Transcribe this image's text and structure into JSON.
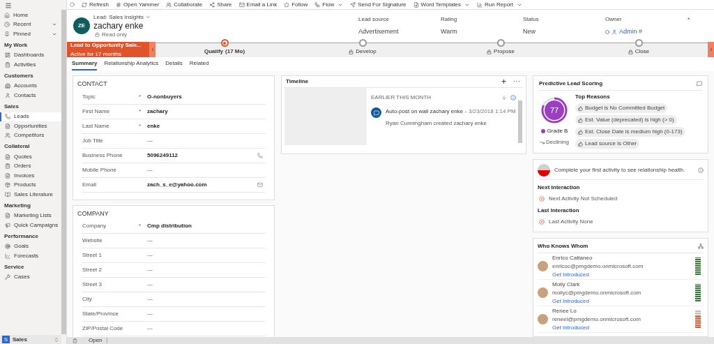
{
  "sidebar": {
    "top_items": [
      {
        "label": "Home",
        "has_menu": false
      },
      {
        "label": "Recent",
        "has_menu": true
      },
      {
        "label": "Pinned",
        "has_menu": true
      }
    ],
    "groups": [
      {
        "title": "My Work",
        "items": [
          {
            "label": "Dashboards",
            "selected": false
          },
          {
            "label": "Activities",
            "selected": false
          }
        ]
      },
      {
        "title": "Customers",
        "items": [
          {
            "label": "Accounts",
            "selected": false
          },
          {
            "label": "Contacts",
            "selected": false
          }
        ]
      },
      {
        "title": "Sales",
        "items": [
          {
            "label": "Leads",
            "selected": true
          },
          {
            "label": "Opportunities",
            "selected": false
          },
          {
            "label": "Competitors",
            "selected": false
          }
        ]
      },
      {
        "title": "Collateral",
        "items": [
          {
            "label": "Quotes",
            "selected": false
          },
          {
            "label": "Orders",
            "selected": false
          },
          {
            "label": "Invoices",
            "selected": false
          },
          {
            "label": "Products",
            "selected": false
          },
          {
            "label": "Sales Literature",
            "selected": false
          }
        ]
      },
      {
        "title": "Marketing",
        "items": [
          {
            "label": "Marketing Lists",
            "selected": false
          },
          {
            "label": "Quick Campaigns",
            "selected": false
          }
        ]
      },
      {
        "title": "Performance",
        "items": [
          {
            "label": "Goals",
            "selected": false
          },
          {
            "label": "Forecasts",
            "selected": false
          }
        ]
      },
      {
        "title": "Service",
        "items": [
          {
            "label": "Cases",
            "selected": false
          }
        ]
      }
    ],
    "area": {
      "badge": "S",
      "label": "Sales"
    }
  },
  "commands": [
    {
      "label": "Refresh",
      "has_menu": false
    },
    {
      "label": "Open Yammer",
      "has_menu": false
    },
    {
      "label": "Collaborate",
      "has_menu": false
    },
    {
      "label": "Share",
      "has_menu": false
    },
    {
      "label": "Email a Link",
      "has_menu": false
    },
    {
      "label": "Follow",
      "has_menu": false
    },
    {
      "label": "Flow",
      "has_menu": true
    },
    {
      "label": "Send For Signature",
      "has_menu": false
    },
    {
      "label": "Word Templates",
      "has_menu": true
    },
    {
      "label": "Run Report",
      "has_menu": true
    }
  ],
  "header": {
    "avatar": "ZE",
    "form": "Lead: Sales Insights",
    "name": "zachary enke",
    "status": "Read only",
    "fields": [
      {
        "label": "Lead source",
        "value": "Advertisement",
        "kind": "text"
      },
      {
        "label": "Rating",
        "value": "Warm",
        "kind": "text"
      },
      {
        "label": "Status",
        "value": "New",
        "kind": "text"
      },
      {
        "label": "Owner",
        "value": "Admin #",
        "kind": "owner"
      }
    ],
    "required_mark": "*"
  },
  "process": {
    "name": "Lead to Opportunity Sale...",
    "active_for": "Active for 17 months",
    "stages": [
      {
        "label": "Qualify",
        "duration": "(17 Mo)",
        "selected": true,
        "locked": false
      },
      {
        "label": "Develop",
        "selected": false,
        "locked": true
      },
      {
        "label": "Propose",
        "selected": false,
        "locked": true
      },
      {
        "label": "Close",
        "selected": false,
        "locked": true
      }
    ]
  },
  "tabs": [
    {
      "label": "Summary",
      "selected": true
    },
    {
      "label": "Relationship Analytics",
      "selected": false
    },
    {
      "label": "Details",
      "selected": false
    },
    {
      "label": "Related",
      "selected": false
    }
  ],
  "sections": [
    {
      "title": "CONTACT",
      "fields": [
        {
          "label": "Topic",
          "mark": "*",
          "recommended": false,
          "value": "O-nonbuyers",
          "empty": false,
          "kind": "text"
        },
        {
          "label": "First Name",
          "mark": "*",
          "recommended": true,
          "value": "zachary",
          "empty": false,
          "kind": "text"
        },
        {
          "label": "Last Name",
          "mark": "*",
          "recommended": false,
          "value": "enke",
          "empty": false,
          "kind": "text"
        },
        {
          "label": "Job Title",
          "value": "---",
          "empty": true,
          "kind": "text"
        },
        {
          "label": "Business Phone",
          "value": "5096249112",
          "empty": false,
          "kind": "phone"
        },
        {
          "label": "Mobile Phone",
          "value": "---",
          "empty": true,
          "kind": "text"
        },
        {
          "label": "Email",
          "value": "zach_s_e@yahoo.com",
          "empty": false,
          "kind": "email"
        }
      ]
    },
    {
      "title": "COMPANY",
      "fields": [
        {
          "label": "Company",
          "mark": "*",
          "recommended": true,
          "value": "Cmp distribution",
          "empty": false,
          "kind": "text"
        },
        {
          "label": "Website",
          "value": "---",
          "empty": true,
          "kind": "text"
        },
        {
          "label": "Street 1",
          "value": "---",
          "empty": true,
          "kind": "text"
        },
        {
          "label": "Street 2",
          "value": "---",
          "empty": true,
          "kind": "text"
        },
        {
          "label": "Street 3",
          "value": "---",
          "empty": true,
          "kind": "text"
        },
        {
          "label": "City",
          "value": "---",
          "empty": true,
          "kind": "text"
        },
        {
          "label": "State/Province",
          "value": "---",
          "empty": true,
          "kind": "text"
        },
        {
          "label": "ZIP/Postal Code",
          "value": "---",
          "empty": true,
          "kind": "text"
        }
      ]
    }
  ],
  "timeline": {
    "title": "Timeline",
    "add": "+",
    "more": "···",
    "group": "EARLIER THIS MONTH",
    "posts": [
      {
        "title": "Auto-post on wall zachary enke -",
        "date": "3/23/2018 1:14 PM",
        "body": "Ryan Cunningham created zachary enke"
      }
    ]
  },
  "scoring": {
    "title": "Predictive Lead Scoring",
    "score": "77",
    "grade": "Grade B",
    "trend": "Declining",
    "reasons_title": "Top Reasons",
    "reasons": [
      "Budget is No Committed Budget",
      "Est. Value (deprecated) is high (> 0)",
      "Est. Close Date is medium high (0-173)",
      "Lead source is Other"
    ]
  },
  "relationship": {
    "message": "Complete your first activity to see relationship health.",
    "items": [
      {
        "title": "Next Interaction",
        "value": "Next Activity Not Scheduled"
      },
      {
        "title": "Last Interaction",
        "value": "Last Activity None"
      }
    ]
  },
  "who_knows_whom": {
    "title": "Who Knows Whom",
    "people": [
      {
        "name": "Enrico Cattaneo",
        "email": "enricoc@pmgdemo.onmicrosoft.com",
        "link": "Get Introduced",
        "level": 1,
        "color": "#2e7d32"
      },
      {
        "name": "Molly Clark",
        "email": "mollyc@pmgdemo.onmicrosoft.com",
        "link": "Get Introduced",
        "level": 1,
        "color": "#2e7d32"
      },
      {
        "name": "Renee Lo",
        "email": "reneel@pmgdemo.onmicrosoft.com",
        "link": "Get Introduced",
        "level": 0.7,
        "color": "#e0532b"
      }
    ]
  },
  "status_bar": {
    "status": "Open"
  }
}
